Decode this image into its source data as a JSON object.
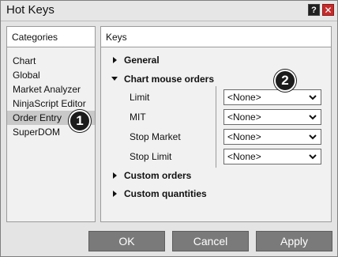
{
  "window": {
    "title": "Hot Keys"
  },
  "titlebar": {
    "help_label": "?",
    "close_label": "✕"
  },
  "categories": {
    "header": "Categories",
    "items": [
      "Chart",
      "Global",
      "Market Analyzer",
      "NinjaScript Editor",
      "Order Entry",
      "SuperDOM"
    ],
    "selected": "Order Entry"
  },
  "keys": {
    "header": "Keys",
    "general": "General",
    "chart_mouse_orders": "Chart mouse orders",
    "rows": [
      {
        "label": "Limit",
        "value": "<None>"
      },
      {
        "label": "MIT",
        "value": "<None>"
      },
      {
        "label": "Stop Market",
        "value": "<None>"
      },
      {
        "label": "Stop Limit",
        "value": "<None>"
      }
    ],
    "custom_orders": "Custom orders",
    "custom_quantities": "Custom quantities"
  },
  "badges": {
    "one": "1",
    "two": "2"
  },
  "buttons": {
    "ok": "OK",
    "cancel": "Cancel",
    "apply": "Apply"
  },
  "colors": {
    "close": "#c62b2b",
    "button": "#7a7a7a",
    "selected": "#c9c9c9"
  }
}
